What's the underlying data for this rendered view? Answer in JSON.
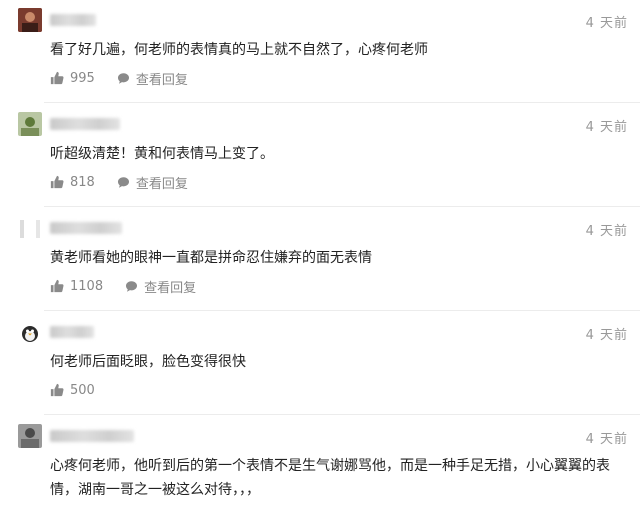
{
  "comments": [
    {
      "time": "4 天前",
      "text": "看了好几遍，何老师的表情真的马上就不自然了，心疼何老师",
      "likes": "995",
      "reply": "查看回复",
      "avatar_color": "#7a3b2e"
    },
    {
      "time": "4 天前",
      "text": "听超级清楚！黄和何表情马上变了。",
      "likes": "818",
      "reply": "查看回复",
      "avatar_color": "#5e7a3a"
    },
    {
      "time": "4 天前",
      "text": "黄老师看她的眼神一直都是拼命忍住嫌弃的面无表情",
      "likes": "1108",
      "reply": "查看回复",
      "avatar_color": "#e6e6e6"
    },
    {
      "time": "4 天前",
      "text": "何老师后面眨眼，脸色变得很快",
      "likes": "500",
      "avatar_color": "#d9d9d9"
    },
    {
      "time": "4 天前",
      "text": "心疼何老师，他听到后的第一个表情不是生气谢娜骂他，而是一种手足无措，小心翼翼的表情，湖南一哥之一被这么对待，，，",
      "avatar_color": "#6b6b6b"
    }
  ]
}
